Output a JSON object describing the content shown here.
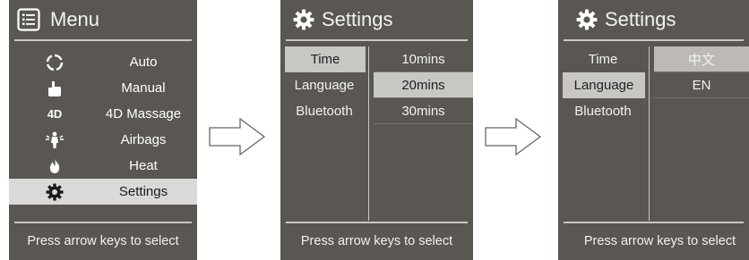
{
  "menu": {
    "title": "Menu",
    "items": [
      {
        "label": "Auto",
        "icon": "auto-cycle-icon"
      },
      {
        "label": "Manual",
        "icon": "hand-icon"
      },
      {
        "label": "4D Massage",
        "icon": "4d-icon",
        "icon_text": "4D"
      },
      {
        "label": "Airbags",
        "icon": "airbag-person-icon"
      },
      {
        "label": "Heat",
        "icon": "flame-icon"
      },
      {
        "label": "Settings",
        "icon": "gear-icon",
        "selected": true
      }
    ],
    "footer": "Press arrow keys to select"
  },
  "settings1": {
    "title": "Settings",
    "left": [
      "Time",
      "Language",
      "Bluetooth"
    ],
    "right": [
      "10mins",
      "20mins",
      "30mins"
    ],
    "left_selected": 0,
    "right_selected": 1,
    "footer": "Press arrow keys to select"
  },
  "settings2": {
    "title": "Settings",
    "left": [
      "Time",
      "Language",
      "Bluetooth"
    ],
    "right": [
      "中文",
      "EN"
    ],
    "left_selected": 1,
    "right_selected": 0,
    "footer": "Press arrow keys to select"
  },
  "colors": {
    "screen_bg": "#5a5651",
    "highlight": "#d9d9d9",
    "rule": "#c9c7c4"
  }
}
